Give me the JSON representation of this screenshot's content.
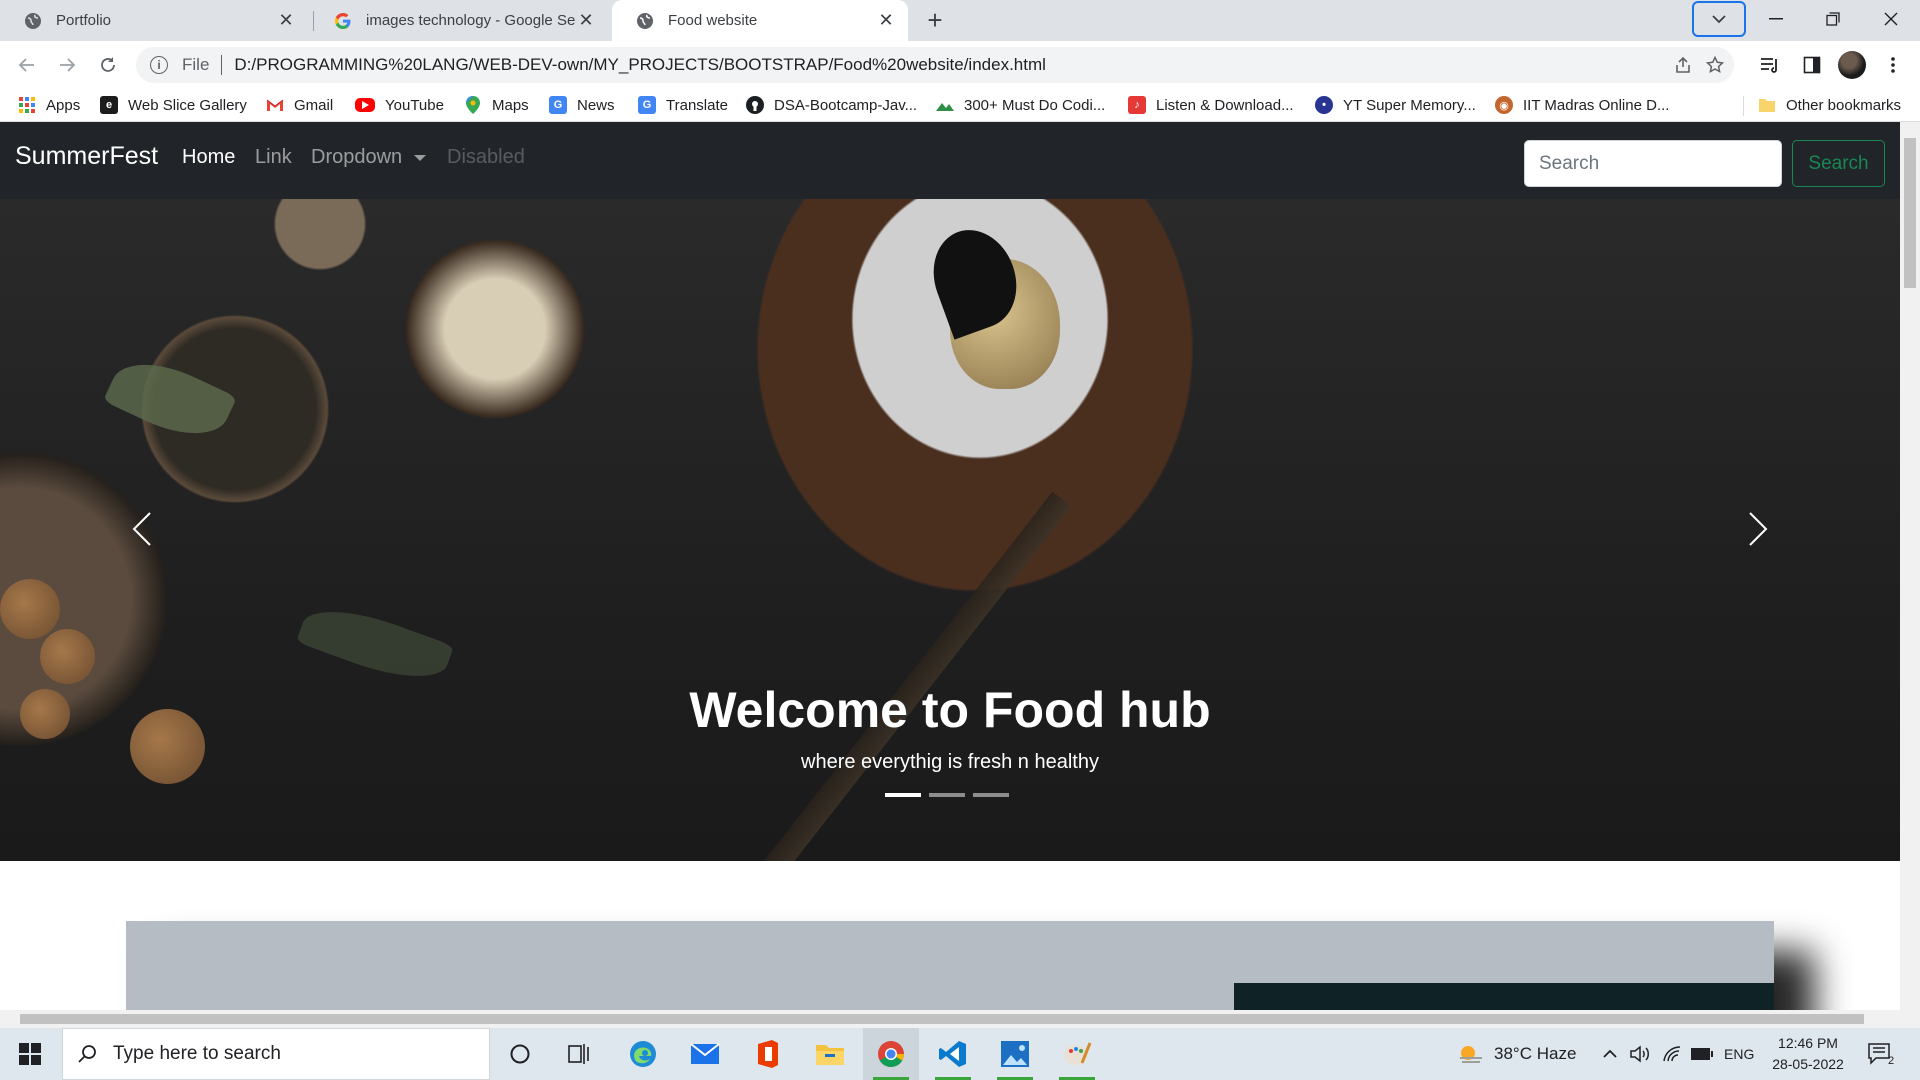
{
  "browser": {
    "tabs": [
      {
        "title": "Portfolio",
        "active": false
      },
      {
        "title": "images technology - Google Search",
        "active": false
      },
      {
        "title": "Food website",
        "active": true
      }
    ],
    "address": {
      "scheme": "File",
      "url": "D:/PROGRAMMING%20LANG/WEB-DEV-own/MY_PROJECTS/BOOTSTRAP/Food%20website/index.html"
    },
    "bookmarks": [
      {
        "label": "Apps",
        "icon": "apps-grid-icon"
      },
      {
        "label": "Web Slice Gallery",
        "icon": "web-slice-icon"
      },
      {
        "label": "Gmail",
        "icon": "gmail-icon"
      },
      {
        "label": "YouTube",
        "icon": "youtube-icon"
      },
      {
        "label": "Maps",
        "icon": "maps-icon"
      },
      {
        "label": "News",
        "icon": "news-icon"
      },
      {
        "label": "Translate",
        "icon": "translate-icon"
      },
      {
        "label": "DSA-Bootcamp-Jav...",
        "icon": "github-icon"
      },
      {
        "label": "300+ Must Do Codi...",
        "icon": "coding-icon"
      },
      {
        "label": "Listen & Download...",
        "icon": "music-icon"
      },
      {
        "label": "YT Super Memory...",
        "icon": "memory-icon"
      },
      {
        "label": "IIT Madras Online D...",
        "icon": "iit-icon"
      }
    ],
    "other_bookmarks": "Other bookmarks"
  },
  "site": {
    "brand": "SummerFest",
    "nav": {
      "home": "Home",
      "link": "Link",
      "dropdown": "Dropdown",
      "disabled": "Disabled"
    },
    "search": {
      "placeholder": "Search",
      "button": "Search"
    },
    "carousel": {
      "title": "Welcome to Food hub",
      "subtitle": "where everythig is fresh n healthy",
      "slides": 3,
      "active_slide": 1
    }
  },
  "taskbar": {
    "search_placeholder": "Type here to search",
    "weather": "38°C  Haze",
    "language": "ENG",
    "time": "12:46 PM",
    "date": "28-05-2022",
    "notifications": "2"
  },
  "colors": {
    "navbar_bg": "#212529",
    "search_button": "#198754",
    "tabstrip": "#dee1e6",
    "tab_search_outline": "#1a73e8"
  }
}
